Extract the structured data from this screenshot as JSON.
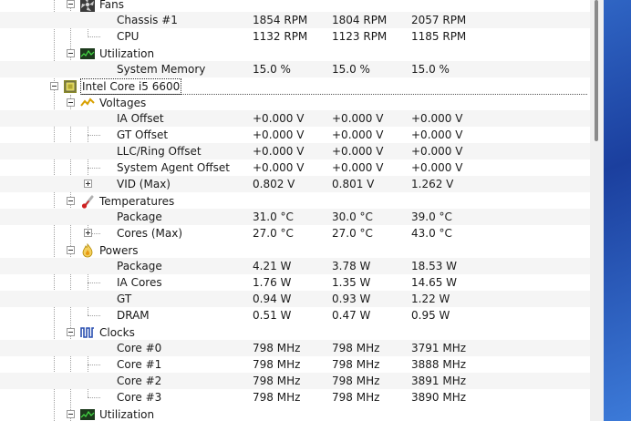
{
  "groups": {
    "fans": "Fans",
    "fans_utilization": "Utilization",
    "cpu": "Intel Core i5 6600",
    "voltages": "Voltages",
    "temperatures": "Temperatures",
    "powers": "Powers",
    "clocks": "Clocks",
    "cpu_utilization": "Utilization"
  },
  "rows": {
    "chassis1": {
      "name": "Chassis #1",
      "v": "1854 RPM",
      "min": "1804 RPM",
      "max": "2057 RPM"
    },
    "cpu_fan": {
      "name": "CPU",
      "v": "1132 RPM",
      "min": "1123 RPM",
      "max": "1185 RPM"
    },
    "sysmem": {
      "name": "System Memory",
      "v": "15.0 %",
      "min": "15.0 %",
      "max": "15.0 %"
    },
    "ia_offset": {
      "name": "IA Offset",
      "v": "+0.000 V",
      "min": "+0.000 V",
      "max": "+0.000 V"
    },
    "gt_offset": {
      "name": "GT Offset",
      "v": "+0.000 V",
      "min": "+0.000 V",
      "max": "+0.000 V"
    },
    "llc_offset": {
      "name": "LLC/Ring Offset",
      "v": "+0.000 V",
      "min": "+0.000 V",
      "max": "+0.000 V"
    },
    "sa_offset": {
      "name": "System Agent Offset",
      "v": "+0.000 V",
      "min": "+0.000 V",
      "max": "+0.000 V"
    },
    "vid_max": {
      "name": "VID (Max)",
      "v": "0.802 V",
      "min": "0.801 V",
      "max": "1.262 V"
    },
    "temp_package": {
      "name": "Package",
      "v": "31.0 °C",
      "min": "30.0 °C",
      "max": "39.0 °C"
    },
    "temp_cores": {
      "name": "Cores (Max)",
      "v": "27.0 °C",
      "min": "27.0 °C",
      "max": "43.0 °C"
    },
    "pow_package": {
      "name": "Package",
      "v": "4.21 W",
      "min": "3.78 W",
      "max": "18.53 W"
    },
    "pow_ia": {
      "name": "IA Cores",
      "v": "1.76 W",
      "min": "1.35 W",
      "max": "14.65 W"
    },
    "pow_gt": {
      "name": "GT",
      "v": "0.94 W",
      "min": "0.93 W",
      "max": "1.22 W"
    },
    "pow_dram": {
      "name": "DRAM",
      "v": "0.51 W",
      "min": "0.47 W",
      "max": "0.95 W"
    },
    "core0": {
      "name": "Core #0",
      "v": "798 MHz",
      "min": "798 MHz",
      "max": "3791 MHz"
    },
    "core1": {
      "name": "Core #1",
      "v": "798 MHz",
      "min": "798 MHz",
      "max": "3888 MHz"
    },
    "core2": {
      "name": "Core #2",
      "v": "798 MHz",
      "min": "798 MHz",
      "max": "3891 MHz"
    },
    "core3": {
      "name": "Core #3",
      "v": "798 MHz",
      "min": "798 MHz",
      "max": "3890 MHz"
    }
  },
  "colors": {
    "desktop_blue": "#2e63c2",
    "alt_row": "#f5f5f5"
  }
}
